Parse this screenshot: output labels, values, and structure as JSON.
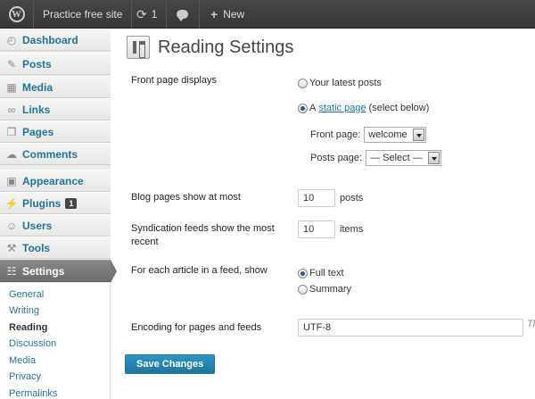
{
  "adminbar": {
    "site_name": "Practice free site",
    "updates_count": "1",
    "new_label": "New"
  },
  "sidebar": {
    "items": [
      {
        "label": "Dashboard",
        "icon": "dashboard-icon"
      },
      {
        "label": "Posts",
        "icon": "pin-icon"
      },
      {
        "label": "Media",
        "icon": "media-icon"
      },
      {
        "label": "Links",
        "icon": "link-icon"
      },
      {
        "label": "Pages",
        "icon": "pages-icon"
      },
      {
        "label": "Comments",
        "icon": "comment-icon"
      },
      {
        "label": "Appearance",
        "icon": "appearance-icon"
      },
      {
        "label": "Plugins",
        "icon": "plugin-icon",
        "badge": "1"
      },
      {
        "label": "Users",
        "icon": "users-icon"
      },
      {
        "label": "Tools",
        "icon": "tools-icon"
      },
      {
        "label": "Settings",
        "icon": "settings-icon"
      }
    ],
    "submenu": [
      "General",
      "Writing",
      "Reading",
      "Discussion",
      "Media",
      "Privacy",
      "Permalinks"
    ]
  },
  "page": {
    "title": "Reading Settings",
    "front_page_label": "Front page displays",
    "opt_latest": "Your latest posts",
    "opt_static_prefix": "A",
    "opt_static_link": "static page",
    "opt_static_suffix": "(select below)",
    "front_page_select_label": "Front page:",
    "front_page_select_value": "welcome",
    "posts_page_select_label": "Posts page:",
    "posts_page_select_value": "— Select —",
    "blog_pages_label": "Blog pages show at most",
    "blog_pages_value": "10",
    "blog_pages_unit": "posts",
    "feeds_label_line1": "Syndication feeds show the most",
    "feeds_label_line2": "recent",
    "feeds_value": "10",
    "feeds_unit": "items",
    "article_label": "For each article in a feed, show",
    "opt_full": "Full text",
    "opt_summary": "Summary",
    "encoding_label": "Encoding for pages and feeds",
    "encoding_value": "UTF-8",
    "encoding_trail": "Th",
    "save_label": "Save Changes"
  }
}
